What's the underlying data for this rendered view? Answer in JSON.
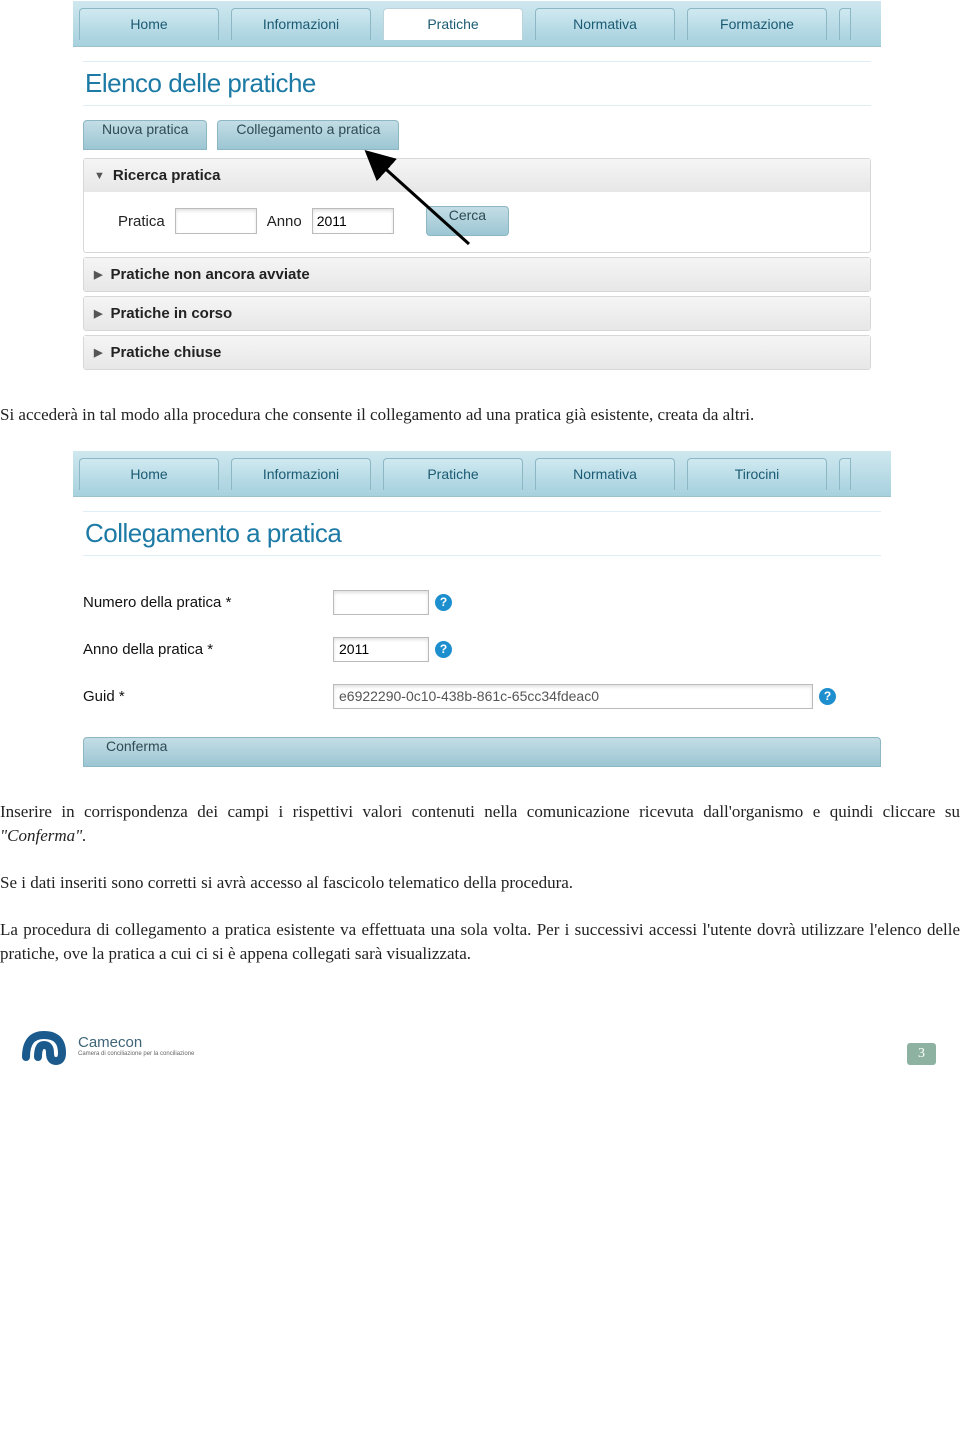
{
  "shot1": {
    "tabs": [
      "Home",
      "Informazioni",
      "Pratiche",
      "Normativa",
      "Formazione"
    ],
    "active_tab_index": 2,
    "heading": "Elenco delle pratiche",
    "action_buttons": [
      "Nuova pratica",
      "Collegamento a pratica"
    ],
    "accordion": {
      "search": {
        "title": "Ricerca pratica",
        "pratica_label": "Pratica",
        "pratica_value": "",
        "anno_label": "Anno",
        "anno_value": "2011",
        "search_button": "Cerca"
      },
      "collapsed": [
        "Pratiche non ancora avviate",
        "Pratiche in corso",
        "Pratiche chiuse"
      ]
    }
  },
  "para1": "Si accederà in tal modo alla procedura che consente il collegamento ad una pratica già esistente, creata da altri.",
  "shot2": {
    "tabs": [
      "Home",
      "Informazioni",
      "Pratiche",
      "Normativa",
      "Tirocini"
    ],
    "heading": "Collegamento a pratica",
    "fields": {
      "numero": {
        "label": "Numero della pratica *",
        "value": ""
      },
      "anno": {
        "label": "Anno della pratica *",
        "value": "2011"
      },
      "guid": {
        "label": "Guid *",
        "value": "e6922290-0c10-438b-861c-65cc34fdeac0"
      }
    },
    "confirm_button": "Conferma"
  },
  "para2_a": "Inserire in corrispondenza dei campi i rispettivi valori contenuti nella comunicazione ricevuta dall'organismo e quindi cliccare su ",
  "para2_b": "\"Conferma\".",
  "para3": "Se i dati inseriti sono corretti si avrà accesso al fascicolo telematico della procedura.",
  "para4": "La procedura di collegamento a pratica esistente va effettuata una sola volta. Per i successivi accessi l'utente dovrà utilizzare l'elenco delle pratiche, ove la pratica a cui ci si è appena collegati sarà visualizzata.",
  "footer": {
    "brand": "Camecon",
    "page": "3"
  }
}
